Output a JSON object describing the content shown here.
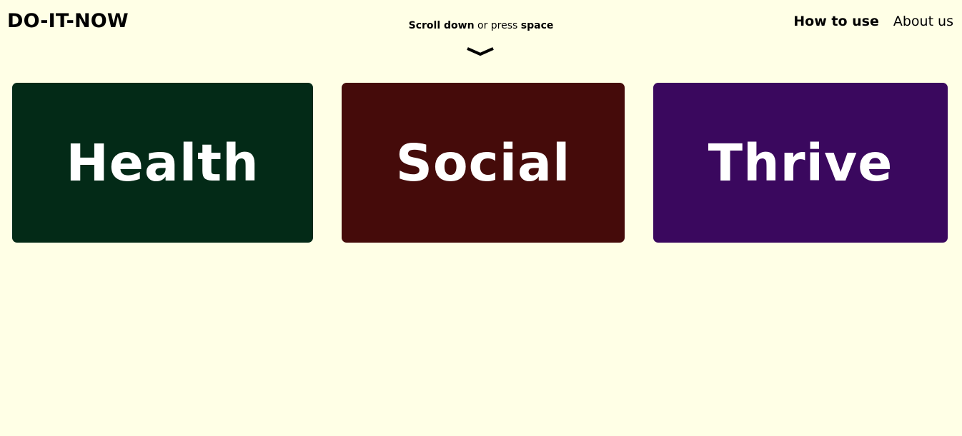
{
  "header": {
    "brand": "DO-IT-NOW",
    "hint": {
      "strong1": "Scroll down",
      "middle": " or press ",
      "strong2": "space"
    },
    "scroll_icon": "chevron-down-icon",
    "nav": [
      {
        "label": "How to use",
        "active": true
      },
      {
        "label": "About us",
        "active": false
      }
    ]
  },
  "cards": [
    {
      "label": "Health",
      "color": "#032a17"
    },
    {
      "label": "Social",
      "color": "#450b0a"
    },
    {
      "label": "Thrive",
      "color": "#3a085e"
    }
  ],
  "colors": {
    "page_background": "#ffffe6",
    "card_text": "#ffffff"
  }
}
